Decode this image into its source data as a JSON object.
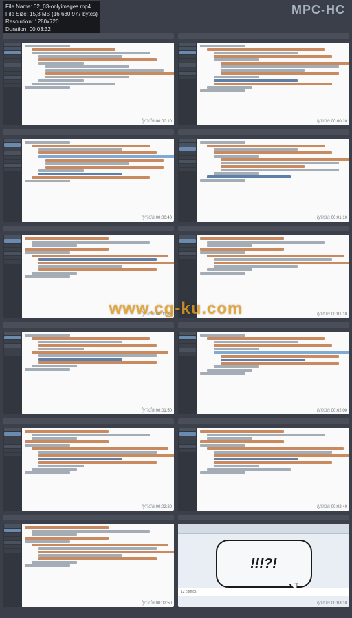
{
  "app_title": "MPC-HC",
  "info": {
    "filename_label": "File Name:",
    "filename": "02_03-onlyimages.mp4",
    "filesize_label": "File Size:",
    "filesize": "15,8 MB (16 630 977 bytes)",
    "resolution_label": "Resolution:",
    "resolution": "1280x720",
    "duration_label": "Duration:",
    "duration": "00:03:32"
  },
  "watermark": "www.cg-ku.com",
  "thumb_logo": "lynda",
  "timestamps": [
    "00:00:10",
    "00:00:10",
    "00:00:40",
    "00:01:10",
    "00:01:38",
    "00:01:10",
    "00:01:50",
    "00:02:00",
    "00:02:20",
    "00:02:40",
    "00:02:50",
    "00:03:10"
  ],
  "browser": {
    "bubble_text": "!!!?!",
    "footer_text": "12 comics"
  }
}
